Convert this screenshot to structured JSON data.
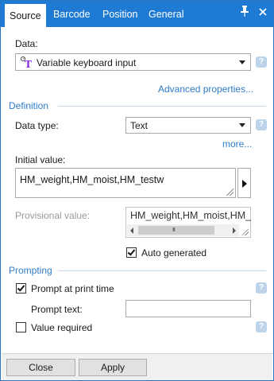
{
  "tabs": [
    {
      "label": "Source"
    },
    {
      "label": "Barcode"
    },
    {
      "label": "Position"
    },
    {
      "label": "General"
    }
  ],
  "icons": {
    "pin": "pin-icon",
    "close": "close-icon",
    "help": "help-icon",
    "variable_type": "variable-keyboard-input-icon"
  },
  "source": {
    "data_label": "Data:",
    "data_value": "Variable keyboard input",
    "advanced_link": "Advanced properties..."
  },
  "definition": {
    "title": "Definition",
    "data_type_label": "Data type:",
    "data_type_value": "Text",
    "more_link": "more...",
    "initial_value_label": "Initial value:",
    "initial_value": "HM_weight,HM_moist,HM_testw",
    "provisional_value_label": "Provisional value:",
    "provisional_value": "HM_weight,HM_moist,HM_",
    "auto_generated_label": "Auto generated",
    "auto_generated_checked": true
  },
  "prompting": {
    "title": "Prompting",
    "prompt_at_print_label": "Prompt at print time",
    "prompt_at_print_checked": true,
    "prompt_text_label": "Prompt text:",
    "prompt_text_value": "",
    "value_required_label": "Value required",
    "value_required_checked": false
  },
  "footer": {
    "close_label": "Close",
    "apply_label": "Apply"
  },
  "colors": {
    "accent": "#1f7ad4",
    "link": "#2f7dc8",
    "help": "#bcd3ea"
  }
}
